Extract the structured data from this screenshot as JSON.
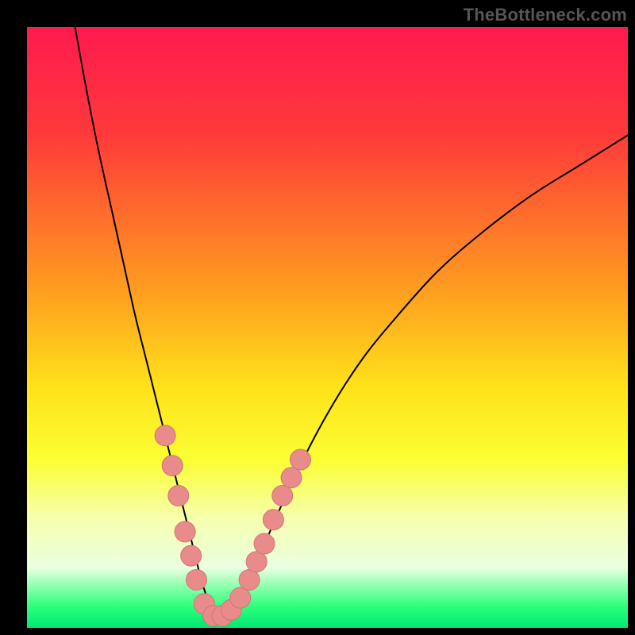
{
  "watermark": "TheBottleneck.com",
  "colors": {
    "frame": "#000000",
    "gradient_stops": [
      {
        "offset": 0.0,
        "hex": "#ff1a4f"
      },
      {
        "offset": 0.18,
        "hex": "#ff3a3a"
      },
      {
        "offset": 0.43,
        "hex": "#ff9a20"
      },
      {
        "offset": 0.6,
        "hex": "#ffe21a"
      },
      {
        "offset": 0.72,
        "hex": "#fbff33"
      },
      {
        "offset": 0.82,
        "hex": "#f6ffb0"
      },
      {
        "offset": 0.9,
        "hex": "#e9ffe0"
      },
      {
        "offset": 0.965,
        "hex": "#2bff7a"
      },
      {
        "offset": 1.0,
        "hex": "#00e874"
      }
    ],
    "curve": "#000000",
    "marker_fill": "#e98b8b",
    "marker_stroke": "#d37474"
  },
  "chart_data": {
    "type": "line",
    "title": "",
    "xlabel": "",
    "ylabel": "",
    "xlim": [
      0,
      100
    ],
    "ylim": [
      0,
      100
    ],
    "grid": false,
    "legend": false,
    "series": [
      {
        "name": "bottleneck-curve",
        "x": [
          8,
          10,
          12,
          14,
          16,
          18,
          20,
          22,
          24,
          26,
          27,
          28,
          29,
          30,
          31,
          32,
          33,
          34,
          36,
          38,
          40,
          44,
          48,
          52,
          56,
          60,
          68,
          76,
          84,
          92,
          100
        ],
        "y": [
          100,
          89,
          79,
          70,
          61,
          52,
          44,
          36,
          28,
          20,
          16,
          12,
          8,
          5,
          3,
          2,
          2,
          3,
          6,
          10,
          15,
          24,
          32,
          39,
          45,
          50,
          59,
          66,
          72,
          77,
          82
        ]
      }
    ],
    "markers": [
      {
        "x": 23.0,
        "y": 32,
        "r": 13
      },
      {
        "x": 24.2,
        "y": 27,
        "r": 13
      },
      {
        "x": 25.2,
        "y": 22,
        "r": 13
      },
      {
        "x": 26.3,
        "y": 16,
        "r": 13
      },
      {
        "x": 27.3,
        "y": 12,
        "r": 13
      },
      {
        "x": 28.2,
        "y": 8,
        "r": 13
      },
      {
        "x": 29.5,
        "y": 4,
        "r": 13
      },
      {
        "x": 31.0,
        "y": 2,
        "r": 13
      },
      {
        "x": 32.5,
        "y": 2,
        "r": 13
      },
      {
        "x": 34.0,
        "y": 3,
        "r": 13
      },
      {
        "x": 35.5,
        "y": 5,
        "r": 13
      },
      {
        "x": 37.0,
        "y": 8,
        "r": 13
      },
      {
        "x": 38.2,
        "y": 11,
        "r": 13
      },
      {
        "x": 39.5,
        "y": 14,
        "r": 13
      },
      {
        "x": 41.0,
        "y": 18,
        "r": 13
      },
      {
        "x": 42.5,
        "y": 22,
        "r": 13
      },
      {
        "x": 44.0,
        "y": 25,
        "r": 13
      },
      {
        "x": 45.5,
        "y": 28,
        "r": 13
      }
    ]
  }
}
